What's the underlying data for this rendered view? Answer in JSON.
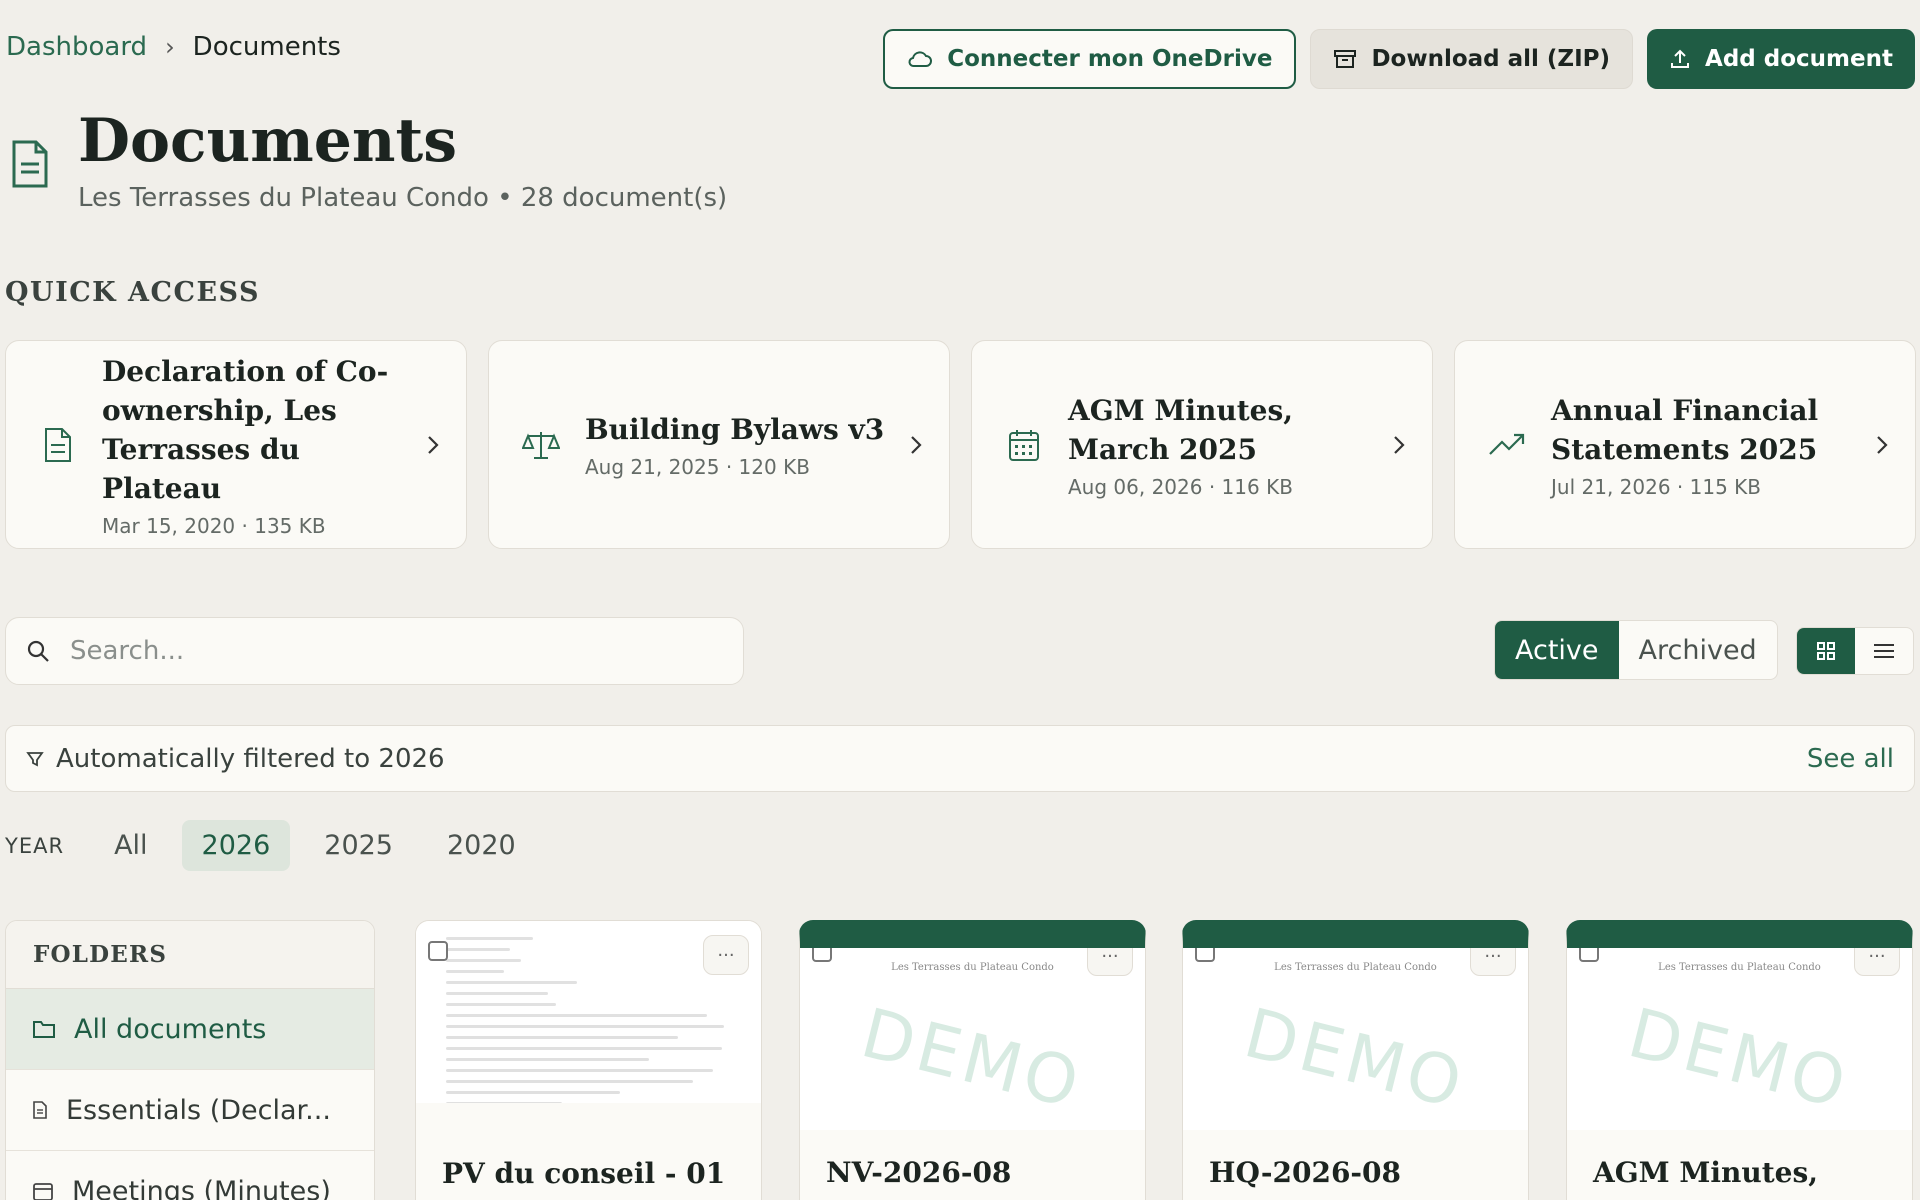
{
  "breadcrumb": {
    "root": "Dashboard",
    "current": "Documents"
  },
  "actions": {
    "onedrive": "Connecter mon OneDrive",
    "download": "Download all (ZIP)",
    "add": "Add document"
  },
  "header": {
    "title": "Documents",
    "subtitle": "Les Terrasses du Plateau Condo • 28 document(s)"
  },
  "quick_access": {
    "label": "QUICK ACCESS",
    "items": [
      {
        "title": "Declaration of Co-ownership, Les Terrasses du Plateau",
        "meta": "Mar 15, 2020 · 135 KB",
        "icon": "document-icon"
      },
      {
        "title": "Building Bylaws v3",
        "meta": "Aug 21, 2025 · 120 KB",
        "icon": "scale-icon"
      },
      {
        "title": "AGM Minutes, March 2025",
        "meta": "Aug 06, 2026 · 116 KB",
        "icon": "calendar-icon"
      },
      {
        "title": "Annual Financial Statements 2025",
        "meta": "Jul 21, 2026 · 115 KB",
        "icon": "trending-up-icon"
      }
    ]
  },
  "search": {
    "placeholder": "Search..."
  },
  "status_toggle": {
    "active": "Active",
    "archived": "Archived",
    "selected": "Active"
  },
  "view_toggle": {
    "selected": "grid"
  },
  "filter": {
    "text": "Automatically filtered to 2026",
    "see_all": "See all"
  },
  "years": {
    "label": "YEAR",
    "options": [
      "All",
      "2026",
      "2025",
      "2020"
    ],
    "selected": "2026"
  },
  "folders": {
    "label": "FOLDERS",
    "items": [
      "All documents",
      "Essentials (Declar...",
      "Meetings (Minutes)"
    ]
  },
  "documents": [
    {
      "title": "PV du conseil - 01"
    },
    {
      "title": "NV-2026-08",
      "watermark": "DEMO",
      "org": "Les Terrasses du Plateau Condo"
    },
    {
      "title": "HQ-2026-08",
      "watermark": "DEMO",
      "org": "Les Terrasses du Plateau Condo"
    },
    {
      "title": "AGM Minutes,",
      "watermark": "DEMO",
      "org": "Les Terrasses du Plateau Condo"
    }
  ],
  "colors": {
    "accent": "#1f5c44",
    "background": "#f1efea",
    "card": "#fbfaf6"
  }
}
